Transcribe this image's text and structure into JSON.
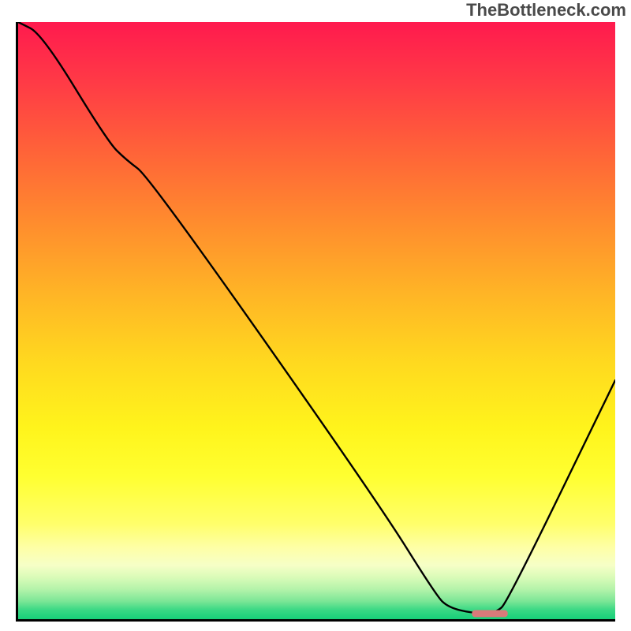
{
  "watermark": "TheBottleneck.com",
  "chart_data": {
    "type": "line",
    "title": "",
    "xlabel": "",
    "ylabel": "",
    "xlim": [
      0,
      100
    ],
    "ylim": [
      0,
      100
    ],
    "grid": false,
    "series": [
      {
        "name": "curve",
        "x": [
          0,
          4,
          15,
          18,
          22,
          60,
          70,
          72,
          76,
          80,
          82,
          100
        ],
        "values": [
          100,
          98,
          80,
          77,
          74,
          20,
          4,
          2,
          1,
          1,
          3,
          40
        ]
      }
    ],
    "marker": {
      "x_start": 76,
      "x_end": 82,
      "y": 1,
      "color": "#d97a7a"
    },
    "gradient_stops": [
      {
        "pos": 0.0,
        "color": "#ff1a4e"
      },
      {
        "pos": 0.33,
        "color": "#ff8a2e"
      },
      {
        "pos": 0.68,
        "color": "#fff41c"
      },
      {
        "pos": 1.0,
        "color": "#17cf79"
      }
    ]
  }
}
